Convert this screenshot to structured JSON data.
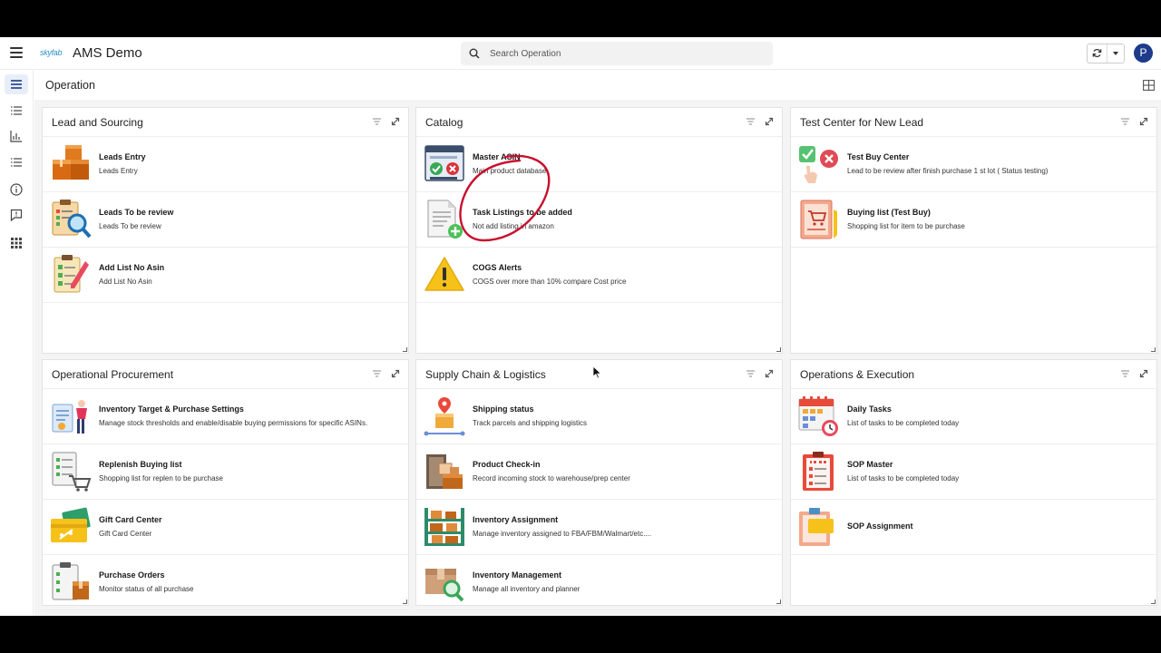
{
  "app": {
    "logo_text": "skyfab",
    "title": "AMS Demo"
  },
  "search": {
    "placeholder": "Search Operation"
  },
  "user": {
    "avatar_initial": "P"
  },
  "page": {
    "title": "Operation"
  },
  "colors": {
    "accent": "#1e3a8a",
    "content_bg": "#f4f4f4",
    "annotation": "#c8102e"
  },
  "cards": [
    {
      "title": "Lead and Sourcing",
      "items": [
        {
          "name": "Leads Entry",
          "desc": "Leads Entry",
          "icon": "boxes-icon"
        },
        {
          "name": "Leads To be review",
          "desc": "Leads To be review",
          "icon": "clipboard-search-icon"
        },
        {
          "name": "Add List No Asin",
          "desc": "Add List No Asin",
          "icon": "checklist-pencil-icon"
        }
      ]
    },
    {
      "title": "Catalog",
      "items": [
        {
          "name": "Master ASIN",
          "desc": "Main product database",
          "icon": "database-window-icon"
        },
        {
          "name": "Task Listings to be added",
          "desc": "Not add listing in amazon",
          "icon": "document-add-icon"
        },
        {
          "name": "COGS Alerts",
          "desc": "COGS over more than 10% compare Cost price",
          "icon": "warning-icon"
        }
      ]
    },
    {
      "title": "Test Center for New Lead",
      "items": [
        {
          "name": "Test Buy Center",
          "desc": "Lead to be review after finish purchase 1 st lot ( Status testing)",
          "icon": "approve-reject-icon"
        },
        {
          "name": "Buying list (Test Buy)",
          "desc": "Shopping list for item to be purchase",
          "icon": "shopping-list-icon"
        }
      ]
    },
    {
      "title": "Operational Procurement",
      "items": [
        {
          "name": "Inventory Target & Purchase Settings",
          "desc": "Manage stock thresholds and enable/disable buying permissions for specific ASINs.",
          "icon": "person-settings-icon"
        },
        {
          "name": "Replenish Buying list",
          "desc": "Shopping list for replen to be purchase",
          "icon": "cart-list-icon"
        },
        {
          "name": "Gift Card Center",
          "desc": "Gift Card Center",
          "icon": "gift-card-icon"
        },
        {
          "name": "Purchase Orders",
          "desc": "Monitor status of all purchase",
          "icon": "clipboard-box-icon"
        }
      ]
    },
    {
      "title": "Supply Chain & Logistics",
      "items": [
        {
          "name": "Shipping status",
          "desc": "Track parcels and shipping logistics",
          "icon": "location-box-icon"
        },
        {
          "name": "Product Check-in",
          "desc": "Record incoming stock to warehouse/prep center",
          "icon": "door-boxes-icon"
        },
        {
          "name": "Inventory Assignment",
          "desc": "Manage inventory assigned to FBA/FBM/Walmart/etc....",
          "icon": "shelf-boxes-icon"
        },
        {
          "name": "Inventory Management",
          "desc": "Manage all inventory and planner",
          "icon": "box-search-icon"
        }
      ]
    },
    {
      "title": "Operations & Execution",
      "items": [
        {
          "name": "Daily Tasks",
          "desc": "List of tasks to be completed today",
          "icon": "calendar-clock-icon"
        },
        {
          "name": "SOP Master",
          "desc": "List of tasks to be completed today",
          "icon": "todo-clipboard-icon"
        },
        {
          "name": "SOP Assignment",
          "desc": "",
          "icon": "sop-clipboard-icon"
        }
      ]
    }
  ]
}
